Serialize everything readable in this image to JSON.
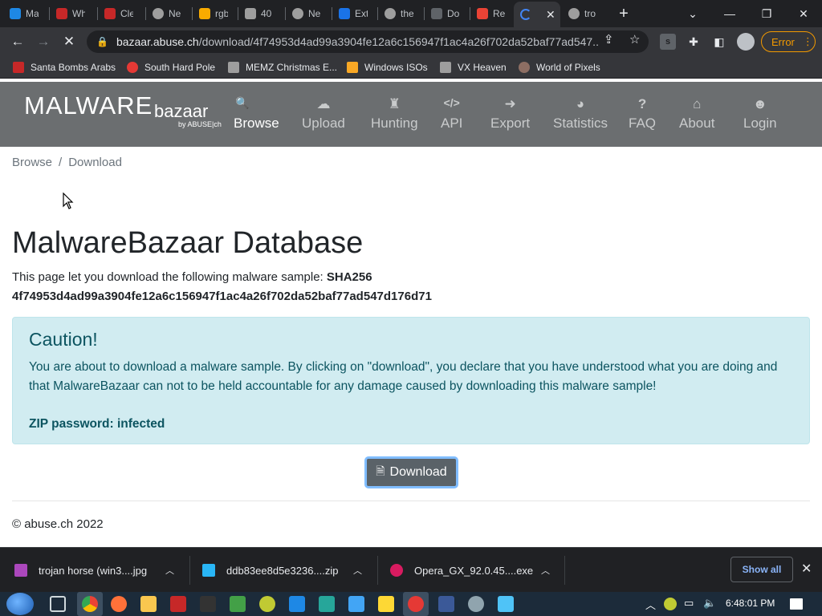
{
  "browser": {
    "tabs": [
      {
        "title": "Ma",
        "color": "#1e88e5"
      },
      {
        "title": "Wh",
        "color": "#c62828"
      },
      {
        "title": "Cle",
        "color": "#c62828"
      },
      {
        "title": "Ne",
        "color": "#9e9e9e"
      },
      {
        "title": "rgb",
        "color": "#f9ab00"
      },
      {
        "title": "40",
        "color": "#9e9e9e"
      },
      {
        "title": "Ne",
        "color": "#9e9e9e"
      },
      {
        "title": "Ext",
        "color": "#1a73e8"
      },
      {
        "title": "the",
        "color": "#9e9e9e"
      },
      {
        "title": "Do",
        "color": "#5f6368"
      },
      {
        "title": "Re",
        "color": "#ea4335"
      },
      {
        "title": "",
        "color": "#4285f4",
        "active": true
      },
      {
        "title": "tro",
        "color": "#9e9e9e"
      }
    ],
    "url_host": "bazaar.abuse.ch",
    "url_path": "/download/4f74953d4ad99a3904fe12a6c156947f1ac4a26f702da52baf77ad547...",
    "error_label": "Error",
    "bookmarks": [
      {
        "label": "Santa Bombs Arabs",
        "color": "#c62828"
      },
      {
        "label": "South Hard Pole",
        "color": "#e53935"
      },
      {
        "label": "MEMZ Christmas E...",
        "color": "#9e9e9e"
      },
      {
        "label": "Windows ISOs",
        "color": "#f9a825"
      },
      {
        "label": "VX Heaven",
        "color": "#9e9e9e"
      },
      {
        "label": "World of Pixels",
        "color": "#8d6e63"
      }
    ]
  },
  "site": {
    "logo_main": "MALWARE",
    "logo_sub": "bazaar",
    "logo_by": "by ABUSE|ch",
    "nav": [
      {
        "label": "Browse",
        "icon": "🔍"
      },
      {
        "label": "Upload",
        "icon": "☁"
      },
      {
        "label": "Hunting",
        "icon": "♜"
      },
      {
        "label": "API",
        "icon": "</>"
      },
      {
        "label": "Export",
        "icon": "➜"
      },
      {
        "label": "Statistics",
        "icon": "◕"
      },
      {
        "label": "FAQ",
        "icon": "?"
      },
      {
        "label": "About",
        "icon": "⌂"
      },
      {
        "label": "Login",
        "icon": "☻"
      }
    ],
    "breadcrumb": {
      "first": "Browse",
      "sep": "/",
      "current": "Download"
    },
    "title": "MalwareBazaar Database",
    "intro_text": "This page let you download the following malware sample: ",
    "intro_label": "SHA256",
    "sha256": "4f74953d4ad99a3904fe12a6c156947f1ac4a26f702da52baf77ad547d176d71",
    "alert_title": "Caution!",
    "alert_text": "You are about to download a malware sample. By clicking on \"download\", you declare that you have understood what you are doing and that MalwareBazaar can not to be held accountable for any damage caused by downloading this malware sample!",
    "zip_password": "ZIP password: infected",
    "download_label": "Download",
    "footer": "© abuse.ch 2022"
  },
  "downloads": {
    "items": [
      {
        "name": "trojan horse (win3....jpg",
        "color": "#ab47bc"
      },
      {
        "name": "ddb83ee8d5e3236....zip",
        "color": "#29b6f6"
      },
      {
        "name": "Opera_GX_92.0.45....exe",
        "color": "#d81b60"
      }
    ],
    "show_all": "Show all"
  },
  "taskbar": {
    "clock": "6:48:01 PM"
  }
}
